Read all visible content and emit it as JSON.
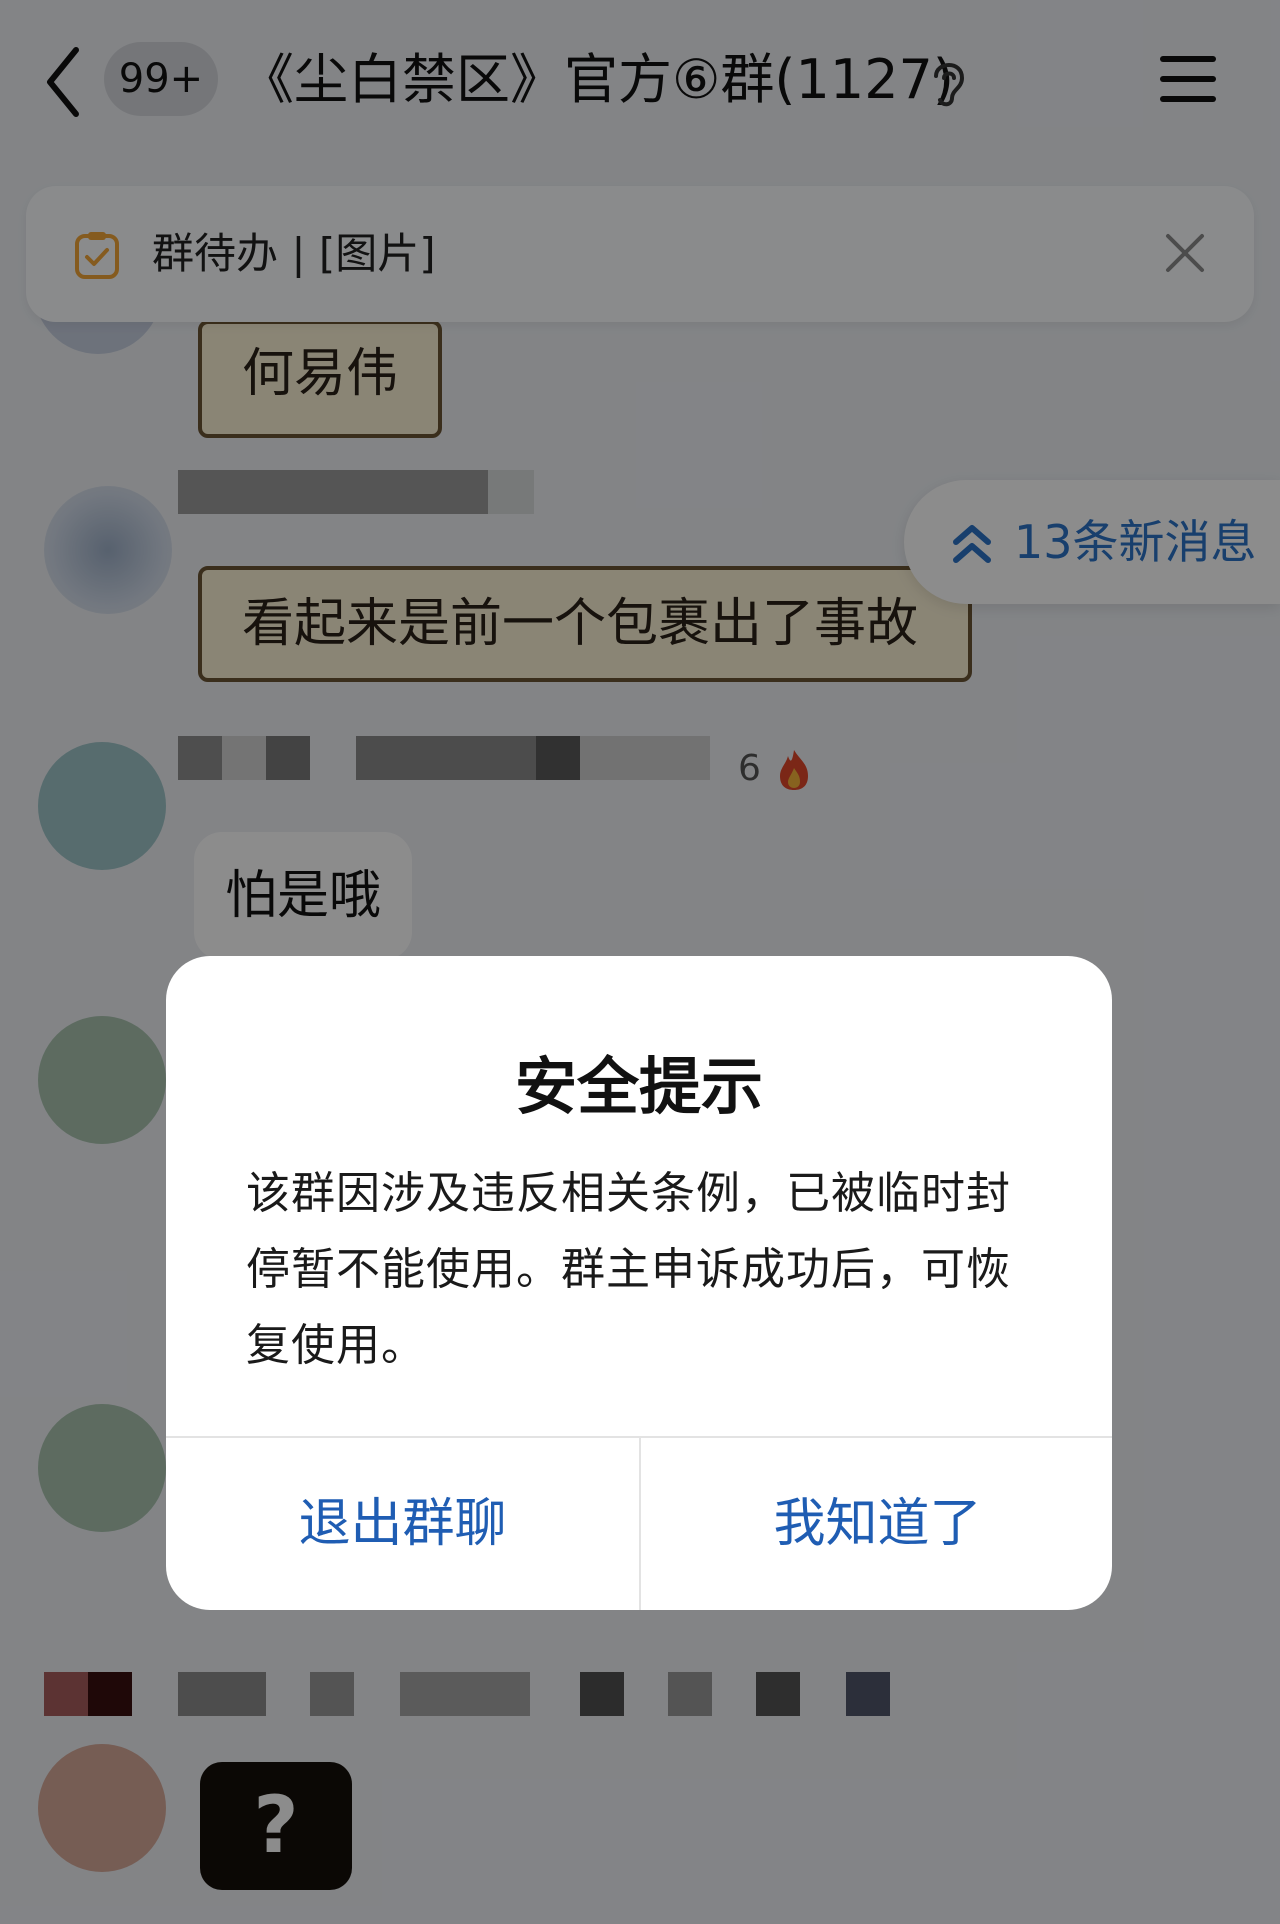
{
  "header": {
    "unread_count": "99+",
    "group_title": "《尘白禁区》官方⑥群(1127)"
  },
  "todo_bar": {
    "text": "群待办 | [图片]"
  },
  "chat": {
    "messages": [
      {
        "text": "何易伟"
      },
      {
        "text": "看起来是前一个包裹出了事故"
      },
      {
        "level": "6",
        "text": "怕是哦"
      },
      {
        "sticker_text": "?"
      }
    ],
    "new_messages_label": "13条新消息"
  },
  "dialog": {
    "title": "安全提示",
    "message": "该群因涉及违反相关条例，已被临时封停暂不能使用。群主申诉成功后，可恢复使用。",
    "exit_button_label": "退出群聊",
    "ok_button_label": "我知道了"
  },
  "colors": {
    "accent_blue": "#1f5db3",
    "new_message_blue": "#2d74c7",
    "overlay": "rgba(0,0,0,0.45)"
  },
  "icons": [
    "back-icon",
    "ear-icon",
    "menu-icon",
    "todo-icon",
    "close-icon",
    "double-chevron-up-icon",
    "fire-icon"
  ]
}
